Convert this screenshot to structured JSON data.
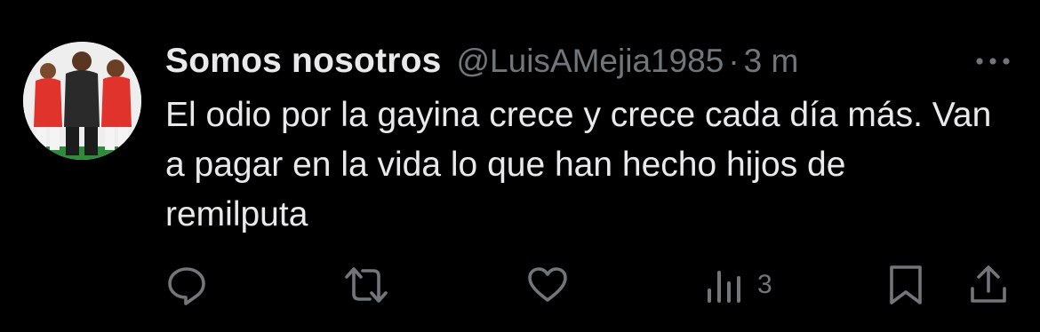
{
  "tweet": {
    "author": {
      "display_name": "Somos nosotros",
      "handle": "@LuisAMejia1985",
      "avatar_icon": "avatar-photo-three-soccer-players"
    },
    "separator": "·",
    "time": "3 m",
    "text": "El odio por la gayina crece y crece cada día más. Van a pagar en la vida lo que han hecho hijos de remilputa",
    "more_icon": "ellipsis-icon"
  },
  "actions": {
    "reply_icon": "reply-icon",
    "retweet_icon": "retweet-icon",
    "like_icon": "heart-icon",
    "views": {
      "icon": "views-icon",
      "count": "3"
    },
    "bookmark_icon": "bookmark-icon",
    "share_icon": "share-icon"
  },
  "colors": {
    "background": "#000000",
    "primary_text": "#e7e9ea",
    "secondary_text": "#71767b"
  }
}
